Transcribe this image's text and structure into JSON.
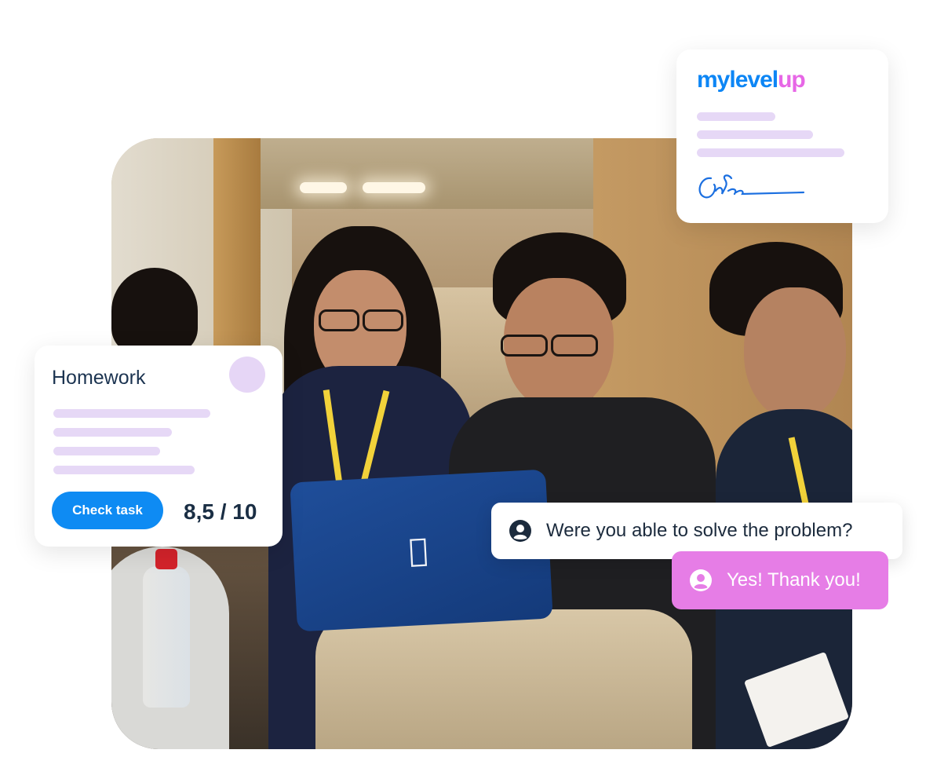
{
  "logo_card": {
    "logo_part1": "mylevel",
    "logo_part2": "up",
    "brand_colors": {
      "blue": "#0d86f5",
      "pink": "#e767e6"
    }
  },
  "homework_card": {
    "title": "Homework",
    "button_label": "Check task",
    "score": "8,5 / 10",
    "accent": "#0e8bf3",
    "placeholder_bar_color": "#e6d8f6"
  },
  "chat": {
    "question": "Were you able to solve the problem?",
    "answer": "Yes! Thank you!",
    "icon": "user-circle-icon",
    "answer_bubble_color": "#e67de6"
  },
  "photo": {
    "icon": "apple-logo-icon"
  }
}
